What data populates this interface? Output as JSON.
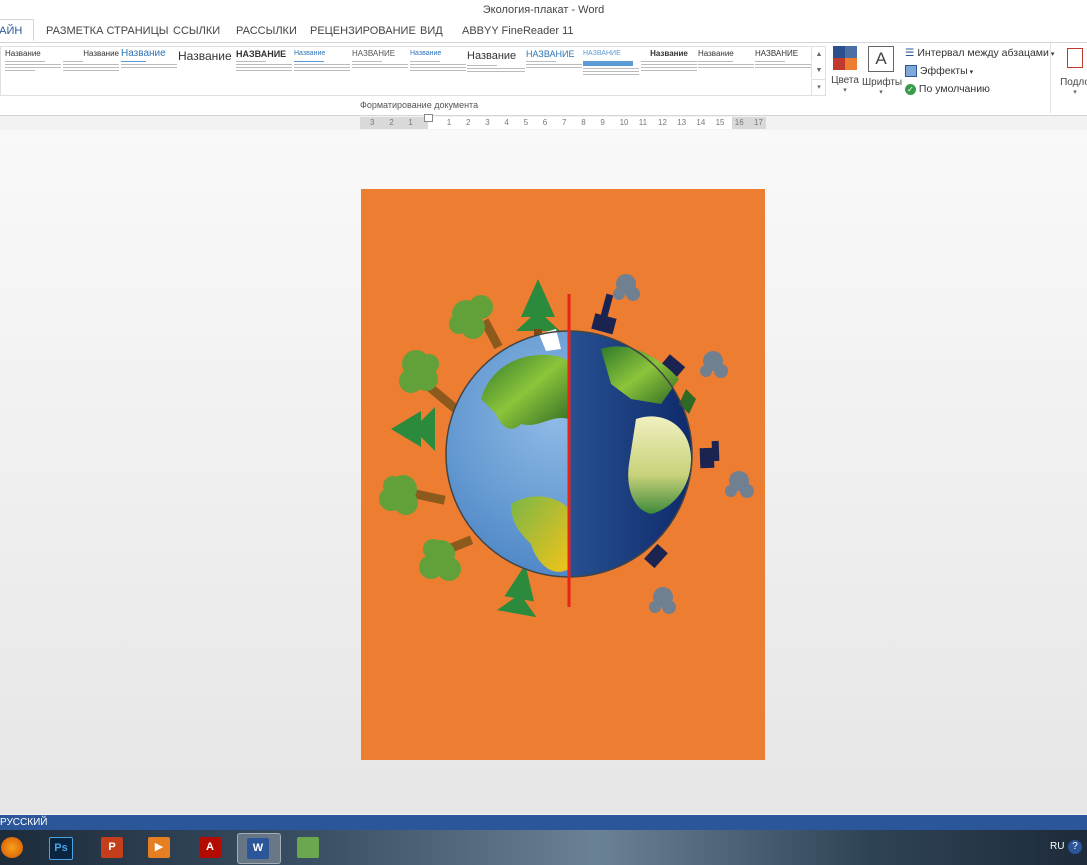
{
  "window": {
    "title": "Экология-плакат - Word"
  },
  "tabs": [
    {
      "label": "ФАЙН",
      "active": true
    },
    {
      "label": "РАЗМЕТКА СТРАНИЦЫ"
    },
    {
      "label": "ССЫЛКИ"
    },
    {
      "label": "РАССЫЛКИ"
    },
    {
      "label": "РЕЦЕНЗИРОВАНИЕ"
    },
    {
      "label": "ВИД"
    },
    {
      "label": "ABBYY FineReader 11"
    }
  ],
  "ribbon": {
    "styles": [
      {
        "title": "Название"
      },
      {
        "title": "Название"
      },
      {
        "title": "Название"
      },
      {
        "title": "Название"
      },
      {
        "title": "НАЗВАНИЕ"
      },
      {
        "title": "Название"
      },
      {
        "title": "НАЗВАНИЕ"
      },
      {
        "title": "Название"
      },
      {
        "title": "Название"
      },
      {
        "title": "НАЗВАНИЕ"
      },
      {
        "title": "НАЗВАНИЕ"
      },
      {
        "title": "Название"
      },
      {
        "title": "Название"
      },
      {
        "title": "НАЗВАНИЕ"
      }
    ],
    "group_label": "Форматирование документа",
    "colors_label": "Цвета",
    "fonts_label": "Шрифты",
    "fonts_glyph": "A",
    "paragraph_spacing": "Интервал между абзацами",
    "effects": "Эффекты",
    "default": "По умолчанию",
    "page_border": "Подло"
  },
  "ruler": {
    "ticks": [
      "3",
      "2",
      "1",
      "",
      "1",
      "2",
      "3",
      "4",
      "5",
      "6",
      "7",
      "8",
      "9",
      "10",
      "11",
      "12",
      "13",
      "14",
      "15",
      "16",
      "17"
    ]
  },
  "document": {
    "background": "#ed7d31",
    "divider_color": "#e8231b"
  },
  "status": {
    "language": "РУССКИЙ"
  },
  "taskbar": {
    "apps": [
      {
        "name": "firefox-icon",
        "label": ""
      },
      {
        "name": "photoshop-icon",
        "label": "Ps"
      },
      {
        "name": "powerpoint-icon",
        "label": "P"
      },
      {
        "name": "media-player-icon",
        "label": "▶"
      },
      {
        "name": "acrobat-icon",
        "label": "A"
      },
      {
        "name": "word-icon",
        "label": "W"
      },
      {
        "name": "drawing-app-icon",
        "label": ""
      }
    ],
    "lang": "RU",
    "help_glyph": "?"
  }
}
